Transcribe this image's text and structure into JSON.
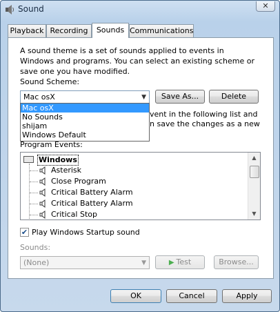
{
  "window": {
    "title": "Sound",
    "close_glyph": "✕"
  },
  "tabs": [
    {
      "label": "Playback"
    },
    {
      "label": "Recording"
    },
    {
      "label": "Sounds"
    },
    {
      "label": "Communications"
    }
  ],
  "sounds_tab": {
    "description": "A sound theme is a set of sounds applied to events in Windows and programs.  You can select an existing scheme or save one you have modified.",
    "scheme_label": "Sound Scheme:",
    "scheme_value": "Mac osX",
    "save_as_label": "Save As...",
    "delete_label": "Delete",
    "dropdown_options": [
      "Mac osX",
      "No Sounds",
      "shijam",
      "Windows Default"
    ],
    "partial_text_1": "vent in the following list and",
    "partial_text_2": "n save the changes as a new",
    "program_events_label": "Program Events:",
    "events_root": "Windows",
    "events": [
      "Asterisk",
      "Close Program",
      "Critical Battery Alarm",
      "Critical Battery Alarm",
      "Critical Stop"
    ],
    "startup_checkbox_label": "Play Windows Startup sound",
    "startup_checked": true,
    "sounds_label": "Sounds:",
    "sounds_value": "(None)",
    "test_label": "Test",
    "browse_label": "Browse..."
  },
  "footer": {
    "ok_label": "OK",
    "cancel_label": "Cancel",
    "apply_label": "Apply"
  },
  "icons": {
    "app": "speaker-icon",
    "event": "speaker-icon",
    "root": "windows-folder-icon"
  },
  "colors": {
    "selection": "#3399ff",
    "titlebar": "#b9d1ea"
  }
}
